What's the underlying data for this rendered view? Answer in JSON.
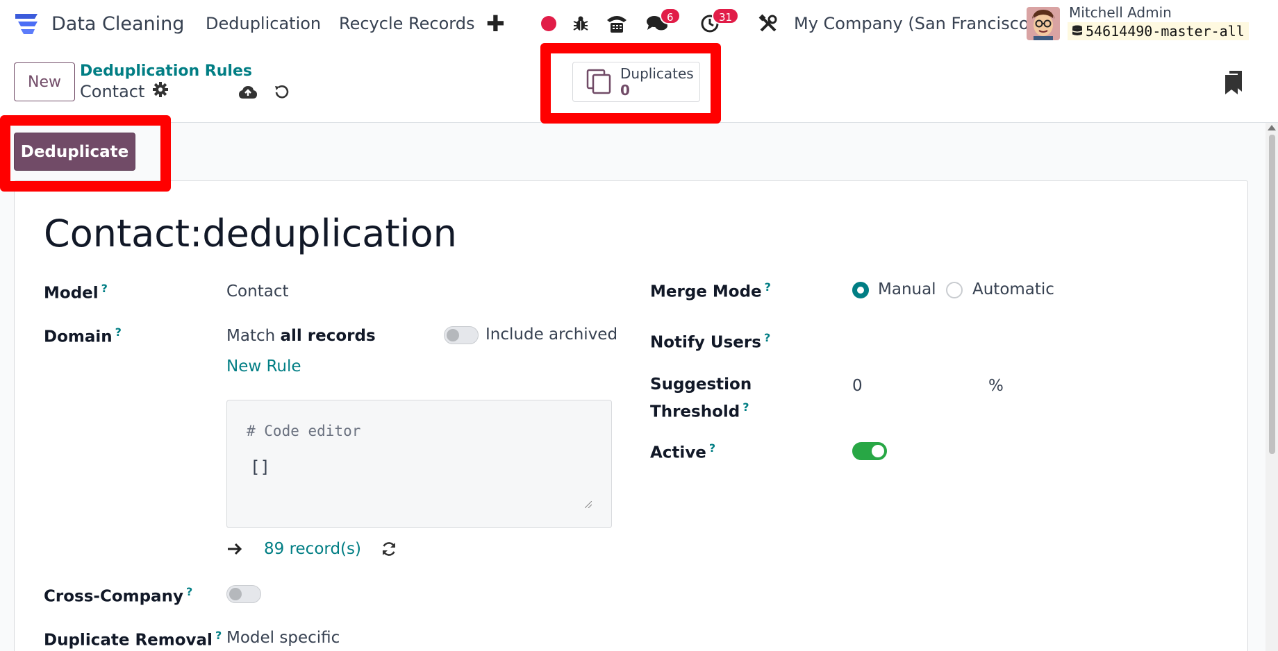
{
  "navbar": {
    "app_name": "Data Cleaning",
    "menu": [
      "Deduplication",
      "Recycle Records"
    ],
    "messages_badge": "6",
    "activities_badge": "31",
    "company": "My Company (San Francisco)",
    "user_name": "Mitchell Admin",
    "database": "54614490-master-all"
  },
  "control_panel": {
    "new_label": "New",
    "breadcrumb_parent": "Deduplication Rules",
    "breadcrumb_current": "Contact",
    "stat_label": "Duplicates",
    "stat_value": "0"
  },
  "statusbar": {
    "deduplicate_label": "Deduplicate"
  },
  "form": {
    "title": "Contact:deduplication",
    "model_label": "Model",
    "model_value": "Contact",
    "domain_label": "Domain",
    "domain_match_prefix": "Match",
    "domain_match_value": "all records",
    "include_archived_label": "Include archived",
    "new_rule_label": "New Rule",
    "code_comment": "# Code editor",
    "code_value": "[]",
    "records_count": "89 record(s)",
    "cross_company_label": "Cross-Company",
    "duplicate_removal_label": "Duplicate Removal",
    "duplicate_removal_value": "Model specific",
    "merge_mode_label": "Merge Mode",
    "merge_mode_options": [
      "Manual",
      "Automatic"
    ],
    "merge_mode_selected": "Manual",
    "notify_users_label": "Notify Users",
    "suggestion_threshold_label_1": "Suggestion",
    "suggestion_threshold_label_2": "Threshold",
    "suggestion_threshold_value": "0",
    "suggestion_threshold_unit": "%",
    "active_label": "Active",
    "active": true,
    "help_mark": "?"
  },
  "colors": {
    "primary": "#714b67",
    "link": "#017e84",
    "highlight": "#ff0000",
    "badge": "#e11d48",
    "toggle_on": "#28a745"
  },
  "icons": [
    "app-logo-icon",
    "record-icon",
    "bug-icon",
    "phone-icon",
    "chat-icon",
    "clock-icon",
    "tools-icon",
    "database-icon",
    "gear-icon",
    "cloud-upload-icon",
    "undo-icon",
    "copy-icon",
    "bookmark-icon",
    "arrow-right-icon",
    "refresh-icon"
  ]
}
